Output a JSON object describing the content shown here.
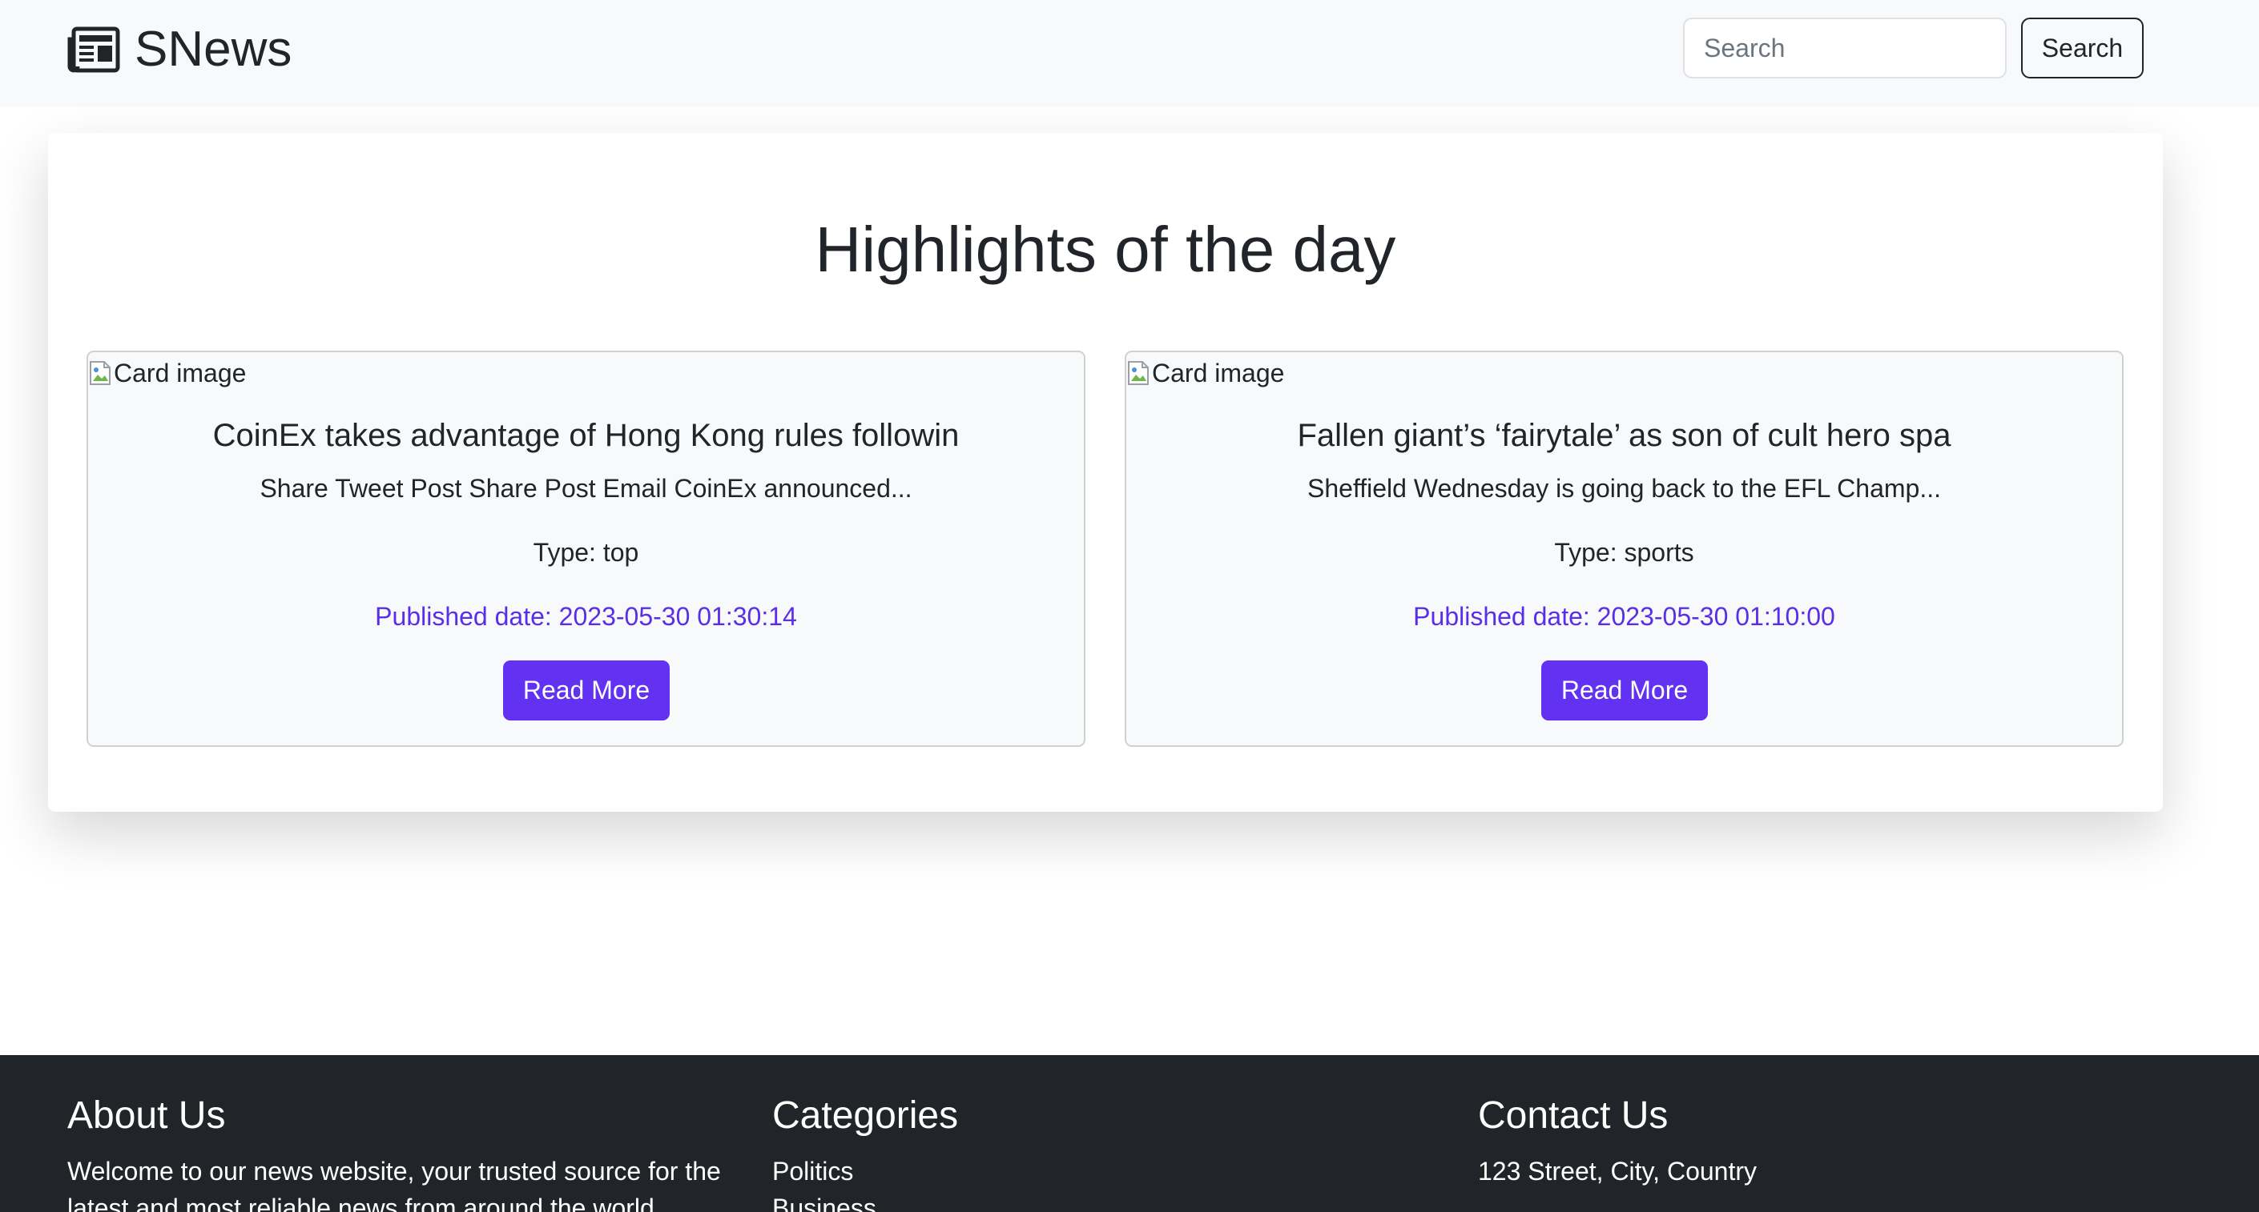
{
  "navbar": {
    "brand_name": "SNews",
    "brand_icon": "newspaper-icon",
    "search_placeholder": "Search",
    "search_value": "",
    "search_button_label": "Search"
  },
  "highlights": {
    "title": "Highlights of the day",
    "cards": [
      {
        "image_alt": "Card image",
        "title": "CoinEx takes advantage of Hong Kong rules followin",
        "description": "Share Tweet Post Share Post Email CoinEx announced...",
        "type": "Type: top",
        "published": "Published date: 2023-05-30 01:30:14",
        "button_label": "Read More"
      },
      {
        "image_alt": "Card image",
        "title": "Fallen giant’s ‘fairytale’ as son of cult hero spa",
        "description": "Sheffield Wednesday is going back to the EFL Champ...",
        "type": "Type: sports",
        "published": "Published date: 2023-05-30 01:10:00",
        "button_label": "Read More"
      }
    ]
  },
  "footer": {
    "about": {
      "heading": "About Us",
      "text": "Welcome to our news website, your trusted source for the latest and most reliable news from around the world."
    },
    "categories": {
      "heading": "Categories",
      "items": [
        "Politics",
        "Business"
      ]
    },
    "contact": {
      "heading": "Contact Us",
      "address": "123 Street, City, Country"
    }
  },
  "colors": {
    "accent": "#6231f2",
    "date_text": "#5a2ee6",
    "navbar_bg": "#f8f9fa",
    "footer_bg": "#212529"
  }
}
